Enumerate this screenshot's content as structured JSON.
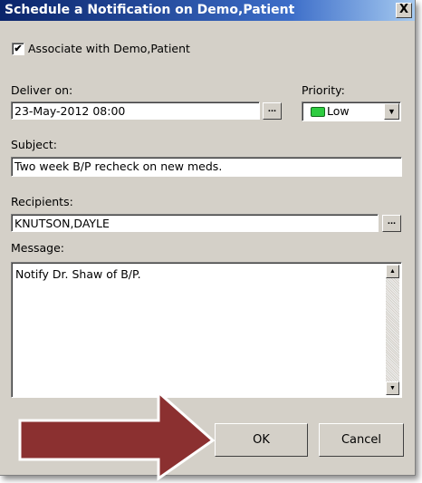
{
  "dialog": {
    "title": "Schedule a Notification on Demo,Patient",
    "close_glyph": "X"
  },
  "associate": {
    "label": "Associate with Demo,Patient",
    "checked": true,
    "check_glyph": "✔"
  },
  "deliver": {
    "label": "Deliver on:",
    "value": "23-May-2012 08:00",
    "button_glyph": "..."
  },
  "priority": {
    "label": "Priority:",
    "value": "Low",
    "color": "#2ecc40",
    "dropdown_glyph": "▼"
  },
  "subject": {
    "label": "Subject:",
    "value": "Two week B/P recheck on new meds."
  },
  "recipients": {
    "label": "Recipients:",
    "value": "KNUTSON,DAYLE",
    "button_glyph": "..."
  },
  "message": {
    "label": "Message:",
    "value": "Notify Dr. Shaw of B/P.",
    "scroll_up_glyph": "▲",
    "scroll_down_glyph": "▼"
  },
  "buttons": {
    "ok": "OK",
    "cancel": "Cancel"
  },
  "annotation": {
    "arrow_color": "#8b3030"
  }
}
